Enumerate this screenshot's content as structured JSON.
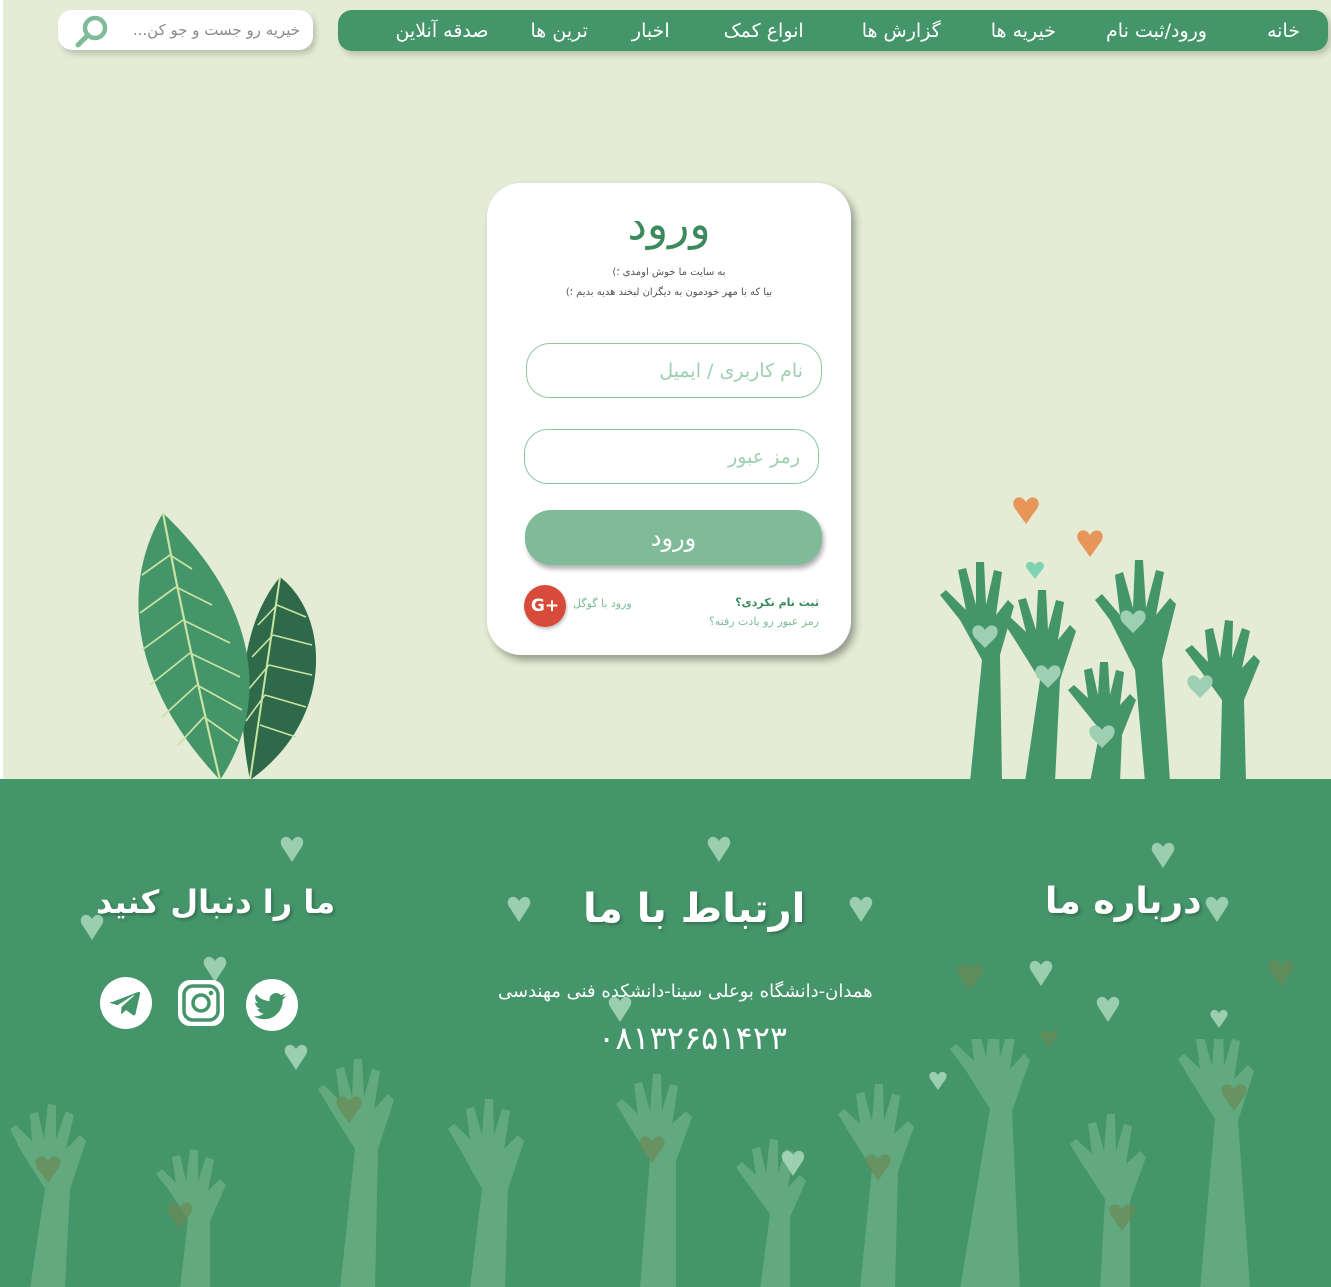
{
  "nav": {
    "items": [
      {
        "label": "خانه"
      },
      {
        "label": "ورود/ثبت نام"
      },
      {
        "label": "خیریه ها"
      },
      {
        "label": "گزارش ها"
      },
      {
        "label": "انواع کمک"
      },
      {
        "label": "اخبار"
      },
      {
        "label": "ترین ها"
      },
      {
        "label": "صدقه آنلاین"
      }
    ]
  },
  "search": {
    "placeholder": "خیریه رو جست و جو کن..."
  },
  "login": {
    "title": "ورود",
    "subtitle1": "به سایت ما خوش اومدی ؛)",
    "subtitle2": "بیا که با مهر خودمون به دیگران لبخند هدیه بدیم ؛)",
    "username_placeholder": "نام کاربری / ایمیل",
    "password_placeholder": "رمز عبور",
    "submit_label": "ورود",
    "google_icon_text": "G+",
    "google_label": "ورود با گوگل",
    "register_link": "ثبت نام نکردی؟",
    "forgot_link": "رمز عبور رو یادت رفته؟"
  },
  "footer": {
    "about_title": "درباره ما",
    "contact_title": "ارتباط با ما",
    "contact_address": "همدان-دانشگاه بوعلی سینا-دانشکده فنی مهندسی",
    "contact_phone": "۰۸۱۳۲۶۵۱۴۲۳",
    "follow_title": "ما را دنبال کنید",
    "social_icons": [
      "twitter-icon",
      "instagram-icon",
      "telegram-icon"
    ]
  },
  "colors": {
    "background": "#e4ecd6",
    "primary_green": "#45956a",
    "button_green": "#7fbb98",
    "google_red": "#d84b3b",
    "heart_orange": "#e8955a"
  }
}
